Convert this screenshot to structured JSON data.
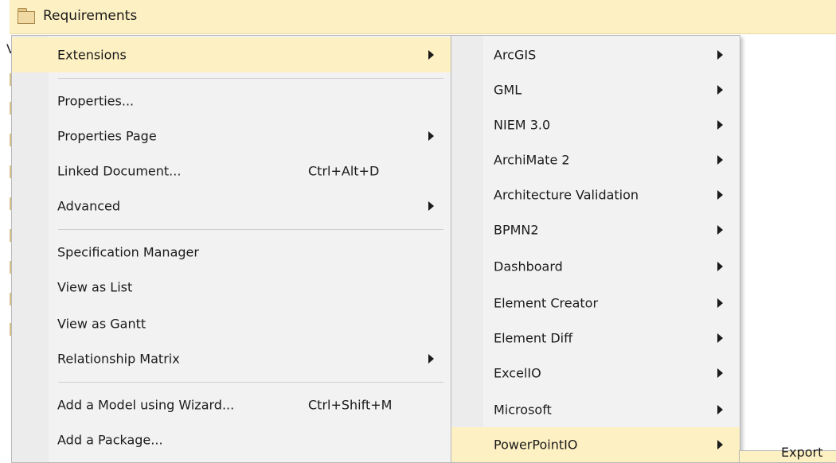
{
  "header": {
    "title": "Requirements",
    "icon": "folder-icon"
  },
  "tree": {
    "partial_text": "V"
  },
  "context_menu": {
    "items": [
      {
        "label": "Extensions",
        "submenu": true,
        "highlighted": true
      },
      {
        "label": "Properties...",
        "submenu": false
      },
      {
        "label": "Properties Page",
        "submenu": true
      },
      {
        "label": "Linked Document...",
        "shortcut": "Ctrl+Alt+D",
        "submenu": false
      },
      {
        "label": "Advanced",
        "submenu": true
      },
      {
        "label": "Specification Manager",
        "submenu": false
      },
      {
        "label": "View as List",
        "submenu": false
      },
      {
        "label": "View as Gantt",
        "submenu": false
      },
      {
        "label": "Relationship Matrix",
        "submenu": true
      },
      {
        "label": "Add a Model using Wizard...",
        "shortcut": "Ctrl+Shift+M",
        "submenu": false
      },
      {
        "label": "Add a Package...",
        "submenu": false
      }
    ]
  },
  "extensions_menu": {
    "items": [
      {
        "label": "ArcGIS"
      },
      {
        "label": "GML"
      },
      {
        "label": "NIEM 3.0"
      },
      {
        "label": "ArchiMate 2"
      },
      {
        "label": "Architecture Validation"
      },
      {
        "label": "BPMN2"
      },
      {
        "label": "Dashboard"
      },
      {
        "label": "Element Creator"
      },
      {
        "label": "Element Diff"
      },
      {
        "label": "ExcelIO"
      },
      {
        "label": "Microsoft"
      },
      {
        "label": "PowerPointIO",
        "highlighted": true
      }
    ]
  },
  "powerpoint_menu": {
    "items": [
      {
        "label": "Export"
      }
    ]
  },
  "colors": {
    "highlight": "#fdf0c2",
    "menu_bg": "#f2f2f2",
    "gutter": "#ececec",
    "border": "#b9b9b9"
  }
}
